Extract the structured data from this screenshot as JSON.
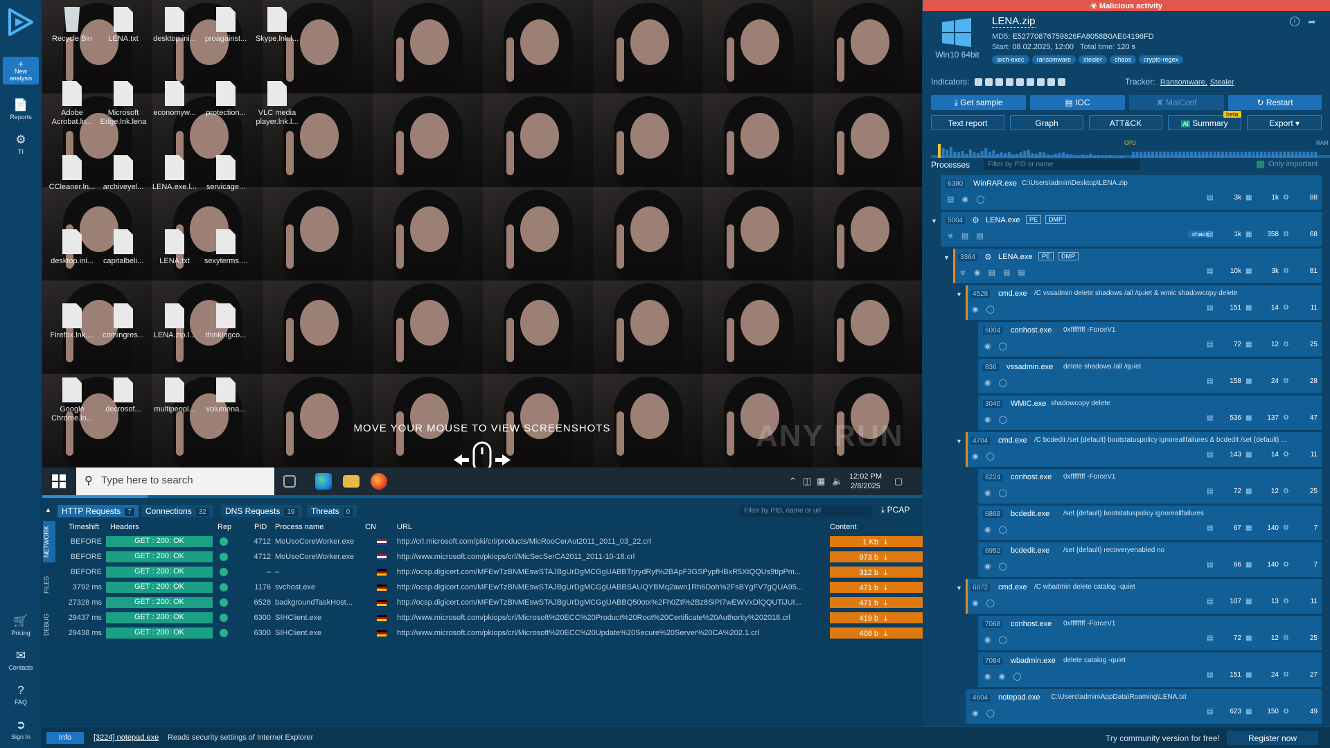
{
  "nav": {
    "new_analysis": "New analysis",
    "reports": "Reports",
    "ti": "TI",
    "pricing": "Pricing",
    "contacts": "Contacts",
    "faq": "FAQ",
    "sign_in": "Sign In"
  },
  "desktop": {
    "icons": [
      {
        "label": "Recycle Bin",
        "icon": "recycle-bin-icon"
      },
      {
        "label": "LENA.txt",
        "icon": "text-file-icon"
      },
      {
        "label": "desktop.ini...",
        "icon": "file-icon"
      },
      {
        "label": "proagainst...",
        "icon": "file-icon"
      },
      {
        "label": "Skype.lnk.l...",
        "icon": "file-icon"
      },
      {
        "label": "Adobe Acrobat.ln...",
        "icon": "file-icon"
      },
      {
        "label": "Microsoft Edge.lnk.lena",
        "icon": "file-icon"
      },
      {
        "label": "economyw...",
        "icon": "file-icon"
      },
      {
        "label": "protection...",
        "icon": "file-icon"
      },
      {
        "label": "VLC media player.lnk.l...",
        "icon": "file-icon"
      },
      {
        "label": "CCleaner.ln...",
        "icon": "file-icon"
      },
      {
        "label": "archiveyel...",
        "icon": "file-icon"
      },
      {
        "label": "LENA.exe.l...",
        "icon": "file-icon"
      },
      {
        "label": "servicage...",
        "icon": "file-icon"
      },
      {
        "label": "desktop.ini...",
        "icon": "file-icon"
      },
      {
        "label": "capitalbeli...",
        "icon": "file-icon"
      },
      {
        "label": "LENA.txt",
        "icon": "text-file-icon"
      },
      {
        "label": "sexyterms....",
        "icon": "file-icon"
      },
      {
        "label": "Firefox.lnk....",
        "icon": "file-icon"
      },
      {
        "label": "comingres...",
        "icon": "file-icon"
      },
      {
        "label": "LENA.zip.l...",
        "icon": "file-icon"
      },
      {
        "label": "thinkingco...",
        "icon": "file-icon"
      },
      {
        "label": "Google Chrome.ln...",
        "icon": "file-icon"
      },
      {
        "label": "decrosof...",
        "icon": "file-icon"
      },
      {
        "label": "multipeopl...",
        "icon": "file-icon"
      },
      {
        "label": "volumena...",
        "icon": "file-icon"
      }
    ],
    "overlay_text": "MOVE YOUR MOUSE TO VIEW SCREENSHOTS",
    "watermark": "ANY RUN"
  },
  "taskbar": {
    "search_placeholder": "Type here to search",
    "time": "12:02 PM",
    "date": "2/8/2025"
  },
  "network": {
    "tabs": [
      {
        "label": "HTTP Requests",
        "count": "7"
      },
      {
        "label": "Connections",
        "count": "32"
      },
      {
        "label": "DNS Requests",
        "count": "19"
      },
      {
        "label": "Threats",
        "count": "0"
      }
    ],
    "filter_placeholder": "Filter by PID, name or url",
    "pcap_label": "PCAP",
    "side_tabs": [
      "NETWORK",
      "FILES",
      "DEBUG"
    ],
    "columns": [
      "Timeshift",
      "Headers",
      "Rep",
      "PID",
      "Process name",
      "CN",
      "URL",
      "Content"
    ],
    "rows": [
      {
        "timeshift": "BEFORE",
        "req": "GET : 200: OK",
        "pid": "4712",
        "process": "MoUsoCoreWorker.exe",
        "cn": "nl",
        "url": "http://crl.microsoft.com/pki/crl/products/MicRooCerAut2011_2011_03_22.crl",
        "size": "1 Kb",
        "type": "binary"
      },
      {
        "timeshift": "BEFORE",
        "req": "GET : 200: OK",
        "pid": "4712",
        "process": "MoUsoCoreWorker.exe",
        "cn": "nl",
        "url": "http://www.microsoft.com/pkiops/crl/MicSecSerCA2011_2011-10-18.crl",
        "size": "973 b",
        "type": "binary"
      },
      {
        "timeshift": "BEFORE",
        "req": "GET : 200: OK",
        "pid": "–",
        "process": "–",
        "cn": "de",
        "url": "http://ocsp.digicert.com/MFEwTzBNMEswSTAJBgUrDgMCGgUABBTrjrydRyt%2BApF3GSPypfHBxR5XtQQUs9tIpPm...",
        "size": "312 b",
        "type": "binary"
      },
      {
        "timeshift": "3792 ms",
        "req": "GET : 200: OK",
        "pid": "1176",
        "process": "svchost.exe",
        "cn": "de",
        "url": "http://ocsp.digicert.com/MFEwTzBNMEswSTAJBgUrDgMCGgUABBSAUQYBMq2awn1Rh6Doh%2FsBYgFV7gQUA95...",
        "size": "471 b",
        "type": "binary"
      },
      {
        "timeshift": "27328 ms",
        "req": "GET : 200: OK",
        "pid": "6528",
        "process": "backgroundTaskHost...",
        "cn": "de",
        "url": "http://ocsp.digicert.com/MFEwTzBNMEswSTAJBgUrDgMCGgUABBQ50otx%2Fh0Ztl%2Bz8SiPI7wEWVxDlQQUTiJUI...",
        "size": "471 b",
        "type": "binary"
      },
      {
        "timeshift": "29437 ms",
        "req": "GET : 200: OK",
        "pid": "6300",
        "process": "SIHClient.exe",
        "cn": "de",
        "url": "http://www.microsoft.com/pkiops/crl/Microsoft%20ECC%20Product%20Root%20Certificate%20Authority%202018.crl",
        "size": "419 b",
        "type": "binary"
      },
      {
        "timeshift": "29438 ms",
        "req": "GET : 200: OK",
        "pid": "6300",
        "process": "SIHClient.exe",
        "cn": "de",
        "url": "http://www.microsoft.com/pkiops/crl/Microsoft%20ECC%20Update%20Secure%20Server%20CA%202.1.crl",
        "size": "408 b",
        "type": "binary"
      }
    ]
  },
  "status": {
    "info_label": "Info",
    "process_ref": "[3224] notepad.exe",
    "message": "Reads security settings of Internet Explorer",
    "community": "Try community version for free!",
    "register": "Register now"
  },
  "task": {
    "banner": "Malicious activity",
    "os_label": "Win10 64bit",
    "file_name": "LENA.zip",
    "md5_label": "MD5:",
    "md5": "E52770876759826FA8058B0AE04196FD",
    "start_label": "Start:",
    "start": "08.02.2025, 12:00",
    "total_label": "Total time:",
    "total": "120 s",
    "tags": [
      "arch-exec",
      "ransomware",
      "stealer",
      "chaos",
      "crypto-regex"
    ],
    "indicators_label": "Indicators:",
    "tracker_label": "Tracker:",
    "tracker_links": [
      "Ransomware,",
      "Stealer"
    ]
  },
  "actions": {
    "get_sample": "Get sample",
    "ioc": "IOC",
    "malconf": "MalConf",
    "restart": "Restart",
    "text_report": "Text report",
    "graph": "Graph",
    "attck": "ATT&CK",
    "summary": "Summary",
    "export": "Export",
    "beta": "beta"
  },
  "graph_labels": {
    "cpu": "CPU",
    "ram": "RAM"
  },
  "processes": {
    "label": "Processes",
    "filter_placeholder": "Filter by PID or name",
    "only_important": "Only important",
    "items": [
      {
        "pid": "6380",
        "name": "WinRAR.exe",
        "cmd": "C:\\Users\\admin\\Desktop\\LENA.zip",
        "files": "3k",
        "reg": "1k",
        "net": "88",
        "badges": [],
        "chaos": ""
      },
      {
        "pid": "5004",
        "name": "LENA.exe",
        "cmd": "",
        "files": "1k",
        "reg": "358",
        "net": "68",
        "badges": [
          "PE",
          "DMP"
        ],
        "chaos": "chaos"
      },
      {
        "pid": "3364",
        "name": "LENA.exe",
        "cmd": "",
        "files": "10k",
        "reg": "3k",
        "net": "81",
        "badges": [
          "PE",
          "DMP"
        ],
        "chaos": ""
      },
      {
        "pid": "4528",
        "name": "cmd.exe",
        "cmd": "/C vssadmin delete shadows /all /quiet & wmic shadowcopy delete",
        "files": "151",
        "reg": "14",
        "net": "11",
        "badges": [],
        "chaos": ""
      },
      {
        "pid": "6004",
        "name": "conhost.exe",
        "cmd": "0xffffffff -ForceV1",
        "files": "72",
        "reg": "12",
        "net": "25",
        "badges": [],
        "chaos": ""
      },
      {
        "pid": "836",
        "name": "vssadmin.exe",
        "cmd": "delete shadows /all /quiet",
        "files": "158",
        "reg": "24",
        "net": "28",
        "badges": [],
        "chaos": ""
      },
      {
        "pid": "3040",
        "name": "WMIC.exe",
        "cmd": "shadowcopy delete",
        "files": "536",
        "reg": "137",
        "net": "47",
        "badges": [],
        "chaos": ""
      },
      {
        "pid": "4704",
        "name": "cmd.exe",
        "cmd": "/C bcdedit /set {default} bootstatuspolicy ignoreallfailures & bcdedit /set {default} ...",
        "files": "143",
        "reg": "14",
        "net": "11",
        "badges": [],
        "chaos": ""
      },
      {
        "pid": "6224",
        "name": "conhost.exe",
        "cmd": "0xffffffff -ForceV1",
        "files": "72",
        "reg": "12",
        "net": "25",
        "badges": [],
        "chaos": ""
      },
      {
        "pid": "6868",
        "name": "bcdedit.exe",
        "cmd": "/set {default} bootstatuspolicy ignoreallfailures",
        "files": "67",
        "reg": "140",
        "net": "7",
        "badges": [],
        "chaos": ""
      },
      {
        "pid": "6952",
        "name": "bcdedit.exe",
        "cmd": "/set {default} recoveryenabled no",
        "files": "66",
        "reg": "140",
        "net": "7",
        "badges": [],
        "chaos": ""
      },
      {
        "pid": "6872",
        "name": "cmd.exe",
        "cmd": "/C wbadmin delete catalog -quiet",
        "files": "107",
        "reg": "13",
        "net": "11",
        "badges": [],
        "chaos": ""
      },
      {
        "pid": "7068",
        "name": "conhost.exe",
        "cmd": "0xffffffff -ForceV1",
        "files": "72",
        "reg": "12",
        "net": "25",
        "badges": [],
        "chaos": ""
      },
      {
        "pid": "7084",
        "name": "wbadmin.exe",
        "cmd": "delete catalog -quiet",
        "files": "151",
        "reg": "24",
        "net": "27",
        "badges": [],
        "chaos": ""
      },
      {
        "pid": "4604",
        "name": "notepad.exe",
        "cmd": "C:\\Users\\admin\\AppData\\Roaming\\LENA.txt",
        "files": "623",
        "reg": "150",
        "net": "49",
        "badges": [],
        "chaos": ""
      }
    ]
  },
  "colors": {
    "banner": "#e2574c",
    "accent": "#1c70b8",
    "content_badge": "#e07a10",
    "request_ok": "#1aa085"
  }
}
